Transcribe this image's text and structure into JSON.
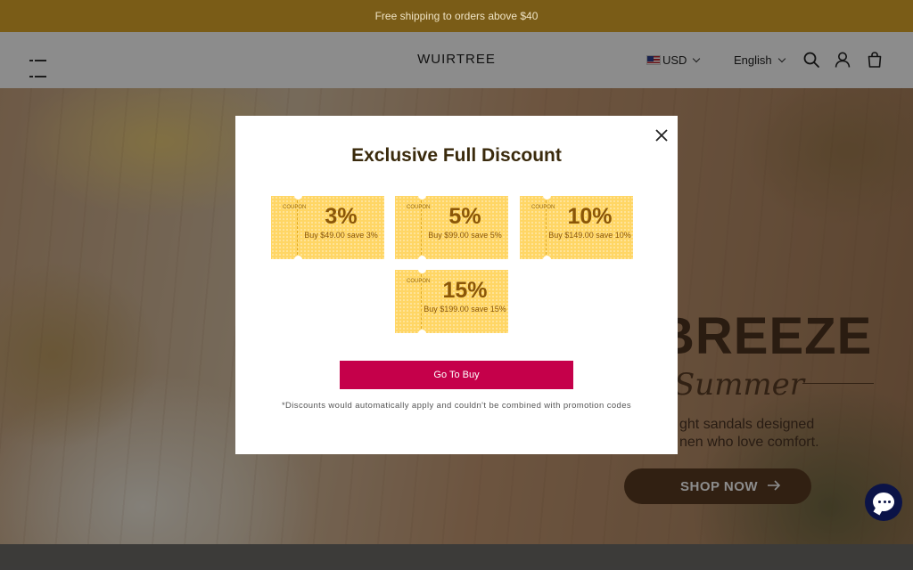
{
  "announcement": {
    "text": "Free shipping to orders above $40"
  },
  "header": {
    "logo": "WUIRTREE",
    "currency": "USD",
    "language": "English",
    "icons": [
      "menu-icon",
      "flag-icon",
      "search-icon",
      "account-icon",
      "cart-icon"
    ]
  },
  "hero": {
    "title": "BREEZE",
    "script_title": "Summer",
    "subtitle_line1": "ght sandals designed",
    "subtitle_line2": "nen who love comfort.",
    "cta": "SHOP NOW"
  },
  "modal": {
    "title": "Exclusive Full Discount",
    "coupon_stub_text": "COUPON",
    "coupons": [
      {
        "percent": "3%",
        "description": "Buy $49.00 save 3%"
      },
      {
        "percent": "5%",
        "description": "Buy $99.00 save 5%"
      },
      {
        "percent": "10%",
        "description": "Buy $149.00 save 10%"
      },
      {
        "percent": "15%",
        "description": "Buy $199.00 save 15%"
      }
    ],
    "button": "Go To Buy",
    "note": "*Discounts would automatically apply and couldn't be combined with promotion codes"
  },
  "colors": {
    "announcement_bg": "#7a5c17",
    "coupon": "#ffd665",
    "coupon_text": "#8a5608",
    "cta_button": "#c5004a",
    "chat_button": "#0b1347"
  }
}
